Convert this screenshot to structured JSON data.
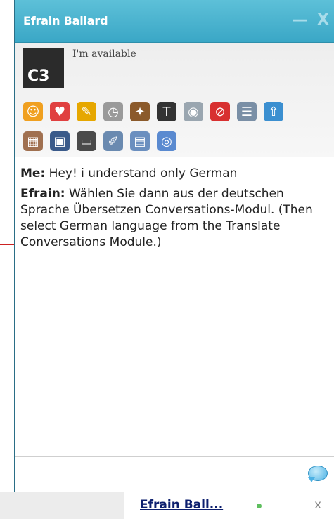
{
  "window": {
    "title": "Efrain Ballard",
    "minimize": "—",
    "close": "X"
  },
  "profile": {
    "avatar_text": "C3",
    "status": "I'm available"
  },
  "toolbar": {
    "row1": [
      {
        "name": "emoticon-icon",
        "glyph": "☺",
        "color": "#f0a020"
      },
      {
        "name": "cards-icon",
        "glyph": "♥",
        "color": "#e04040"
      },
      {
        "name": "pencil-icon",
        "glyph": "✎",
        "color": "#e6a700"
      },
      {
        "name": "clock-icon",
        "glyph": "◷",
        "color": "#9a9a9a"
      },
      {
        "name": "broom-icon",
        "glyph": "✦",
        "color": "#8b5a2b"
      },
      {
        "name": "text-format-icon",
        "glyph": "T",
        "color": "#333333"
      },
      {
        "name": "webcam-icon",
        "glyph": "◉",
        "color": "#9aa6b0"
      },
      {
        "name": "block-icon",
        "glyph": "⊘",
        "color": "#d83030"
      },
      {
        "name": "list-icon",
        "glyph": "☰",
        "color": "#7a8fa6"
      },
      {
        "name": "upload-icon",
        "glyph": "⇧",
        "color": "#3b8fd0"
      }
    ],
    "row2": [
      {
        "name": "firewall-icon",
        "glyph": "▦",
        "color": "#a07050"
      },
      {
        "name": "save-icon",
        "glyph": "▣",
        "color": "#3a5a8a"
      },
      {
        "name": "screen-share-icon",
        "glyph": "▭",
        "color": "#4a4a4a"
      },
      {
        "name": "edit-note-icon",
        "glyph": "✐",
        "color": "#6a8ab0"
      },
      {
        "name": "document-icon",
        "glyph": "▤",
        "color": "#6b8fbf"
      },
      {
        "name": "video-call-icon",
        "glyph": "◎",
        "color": "#5a8ad0"
      }
    ]
  },
  "messages": [
    {
      "sender": "Me:",
      "text": "Hey! i understand only German"
    },
    {
      "sender": "Efrain:",
      "text": "Wählen Sie dann aus der deutschen Sprache Übersetzen Conversations-Modul. (Then select German language from the Translate Conversations Module.)"
    }
  ],
  "taskbar": {
    "tab_name": "Efrain Ball...",
    "close": "x"
  }
}
